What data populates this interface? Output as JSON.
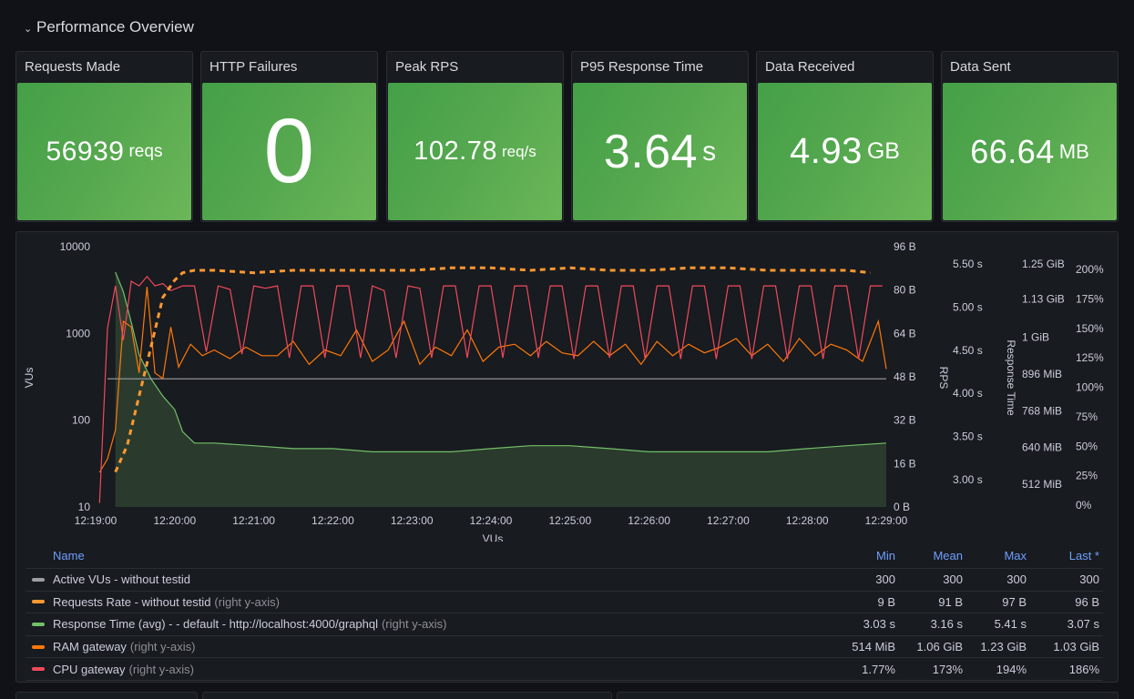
{
  "row": {
    "title": "Performance Overview",
    "chevron_icon": "chevron-down-icon"
  },
  "stats": [
    {
      "title": "Requests Made",
      "value": "56939",
      "unit": "reqs"
    },
    {
      "title": "HTTP Failures",
      "value": "0",
      "unit": ""
    },
    {
      "title": "Peak RPS",
      "value": "102.78",
      "unit": "req/s"
    },
    {
      "title": "P95 Response Time",
      "value": "3.64",
      "unit": "s"
    },
    {
      "title": "Data Received",
      "value": "4.93",
      "unit": "GB"
    },
    {
      "title": "Data Sent",
      "value": "66.64",
      "unit": "MB"
    }
  ],
  "colors": {
    "stat_green": "#56a84f",
    "vus": "#9d9da3",
    "requests_rate": "#ff9830",
    "response_time": "#73bf69",
    "ram": "#ff780a",
    "cpu": "#f2495c",
    "legend_header": "#6e9fff"
  },
  "chart_data": {
    "type": "line",
    "title": "",
    "xlabel": "VUs",
    "x_ticks": [
      "12:19:00",
      "12:20:00",
      "12:21:00",
      "12:22:00",
      "12:23:00",
      "12:24:00",
      "12:25:00",
      "12:26:00",
      "12:27:00",
      "12:28:00",
      "12:29:00"
    ],
    "x_range_minutes": [
      0,
      10
    ],
    "axes": {
      "left": {
        "label": "VUs",
        "scale": "log",
        "range": [
          10,
          10000
        ],
        "ticks": [
          "10",
          "100",
          "1000",
          "10000"
        ]
      },
      "rps": {
        "label": "RPS",
        "range": [
          0,
          96
        ],
        "ticks": [
          "0 B",
          "16 B",
          "32 B",
          "48 B",
          "64 B",
          "80 B",
          "96 B"
        ]
      },
      "resp": {
        "label": "Response Time",
        "range": [
          2.75,
          5.5
        ],
        "ticks": [
          "3.00 s",
          "3.50 s",
          "4.00 s",
          "4.50 s",
          "5.00 s",
          "5.50 s"
        ]
      },
      "ram": {
        "label": "",
        "range_mib": [
          384,
          1280
        ],
        "ticks": [
          "512 MiB",
          "640 MiB",
          "768 MiB",
          "896 MiB",
          "1 GiB",
          "1.13 GiB",
          "1.25 GiB"
        ]
      },
      "cpu": {
        "label": "",
        "range": [
          0,
          200
        ],
        "ticks": [
          "0%",
          "25%",
          "50%",
          "75%",
          "100%",
          "125%",
          "150%",
          "175%",
          "200%"
        ]
      }
    },
    "series": [
      {
        "name": "Active VUs - without testid",
        "axis": "left",
        "style": "solid",
        "values_desc": "constant 300 from 12:19:10 to 12:29:00",
        "x": [
          0.15,
          10
        ],
        "y": [
          300,
          300
        ]
      },
      {
        "name": "Requests Rate - without testid",
        "axis": "rps",
        "style": "dashed",
        "x": [
          0.25,
          0.4,
          0.55,
          0.7,
          0.85,
          1.0,
          1.1,
          1.25,
          1.5,
          2,
          2.5,
          3,
          3.5,
          4,
          4.5,
          5,
          5.5,
          6,
          6.5,
          7,
          7.5,
          8,
          8.5,
          9,
          9.5,
          9.8
        ],
        "y": [
          9,
          25,
          45,
          65,
          85,
          92,
          95,
          96,
          96,
          95,
          96,
          96,
          96,
          96,
          97,
          97,
          96,
          97,
          96,
          96,
          97,
          97,
          96,
          96,
          96,
          95
        ]
      },
      {
        "name": "Response Time (avg) - - default - http://localhost:4000/graphql",
        "axis": "resp",
        "style": "area",
        "x": [
          0.25,
          0.35,
          0.45,
          0.55,
          0.7,
          0.85,
          1.0,
          1.1,
          1.25,
          1.5,
          2,
          2.5,
          3,
          3.5,
          4,
          4.5,
          5,
          5.5,
          6,
          6.5,
          7,
          7.5,
          8,
          8.5,
          9,
          9.5,
          10
        ],
        "y": [
          5.41,
          4.6,
          4.15,
          3.75,
          3.5,
          3.35,
          3.25,
          3.12,
          3.07,
          3.07,
          3.06,
          3.05,
          3.05,
          3.04,
          3.04,
          3.04,
          3.05,
          3.06,
          3.06,
          3.05,
          3.04,
          3.04,
          3.04,
          3.04,
          3.05,
          3.06,
          3.07
        ]
      },
      {
        "name": "RAM gateway",
        "axis": "ram",
        "x": [
          0.05,
          0.15,
          0.25,
          0.35,
          0.45,
          0.55,
          0.65,
          0.75,
          0.85,
          0.95,
          1.05,
          1.2,
          1.35,
          1.5,
          1.7,
          1.9,
          2.1,
          2.3,
          2.5,
          2.7,
          2.9,
          3.1,
          3.3,
          3.5,
          3.7,
          3.9,
          4.1,
          4.3,
          4.5,
          4.7,
          4.9,
          5.1,
          5.3,
          5.5,
          5.7,
          5.9,
          6.1,
          6.3,
          6.5,
          6.7,
          6.9,
          7.1,
          7.3,
          7.5,
          7.7,
          7.9,
          8.1,
          8.3,
          8.5,
          8.7,
          8.9,
          9.1,
          9.3,
          9.5,
          9.7,
          9.9,
          10
        ],
        "y": [
          514,
          600,
          700,
          1080,
          1060,
          900,
          1200,
          900,
          880,
          1060,
          920,
          1000,
          960,
          980,
          950,
          990,
          960,
          960,
          1010,
          930,
          980,
          960,
          1050,
          940,
          980,
          1080,
          930,
          990,
          960,
          1050,
          940,
          990,
          1000,
          960,
          1010,
          970,
          960,
          1010,
          960,
          1000,
          930,
          1010,
          960,
          1000,
          970,
          990,
          1020,
          960,
          1000,
          940,
          1020,
          960,
          1000,
          980,
          940,
          1080,
          914
        ]
      },
      {
        "name": "CPU gateway",
        "axis": "cpu",
        "x": [
          0.05,
          0.15,
          0.25,
          0.35,
          0.45,
          0.55,
          0.65,
          0.75,
          0.85,
          0.95,
          1.1,
          1.25,
          1.4,
          1.55,
          1.7,
          1.85,
          2.0,
          2.15,
          2.3,
          2.45,
          2.6,
          2.75,
          2.9,
          3.05,
          3.2,
          3.35,
          3.5,
          3.65,
          3.8,
          3.95,
          4.1,
          4.25,
          4.4,
          4.55,
          4.7,
          4.85,
          5.0,
          5.15,
          5.3,
          5.45,
          5.6,
          5.75,
          5.9,
          6.05,
          6.2,
          6.35,
          6.5,
          6.65,
          6.8,
          6.95,
          7.1,
          7.25,
          7.4,
          7.55,
          7.7,
          7.85,
          8.0,
          8.15,
          8.3,
          8.45,
          8.6,
          8.75,
          8.9,
          9.05,
          9.2,
          9.35,
          9.5,
          9.65,
          9.8,
          9.95
        ],
        "y": [
          1.77,
          150,
          186,
          140,
          190,
          186,
          194,
          186,
          188,
          182,
          186,
          186,
          130,
          186,
          183,
          128,
          186,
          184,
          186,
          125,
          186,
          186,
          125,
          186,
          186,
          125,
          186,
          182,
          125,
          186,
          184,
          125,
          186,
          186,
          125,
          186,
          186,
          125,
          186,
          186,
          125,
          186,
          186,
          124,
          186,
          186,
          125,
          186,
          186,
          124,
          186,
          186,
          124,
          186,
          186,
          124,
          186,
          186,
          124,
          186,
          186,
          124,
          186,
          186,
          124,
          186,
          186,
          124,
          186,
          186
        ]
      }
    ],
    "legend": {
      "placement": "bottom",
      "columns": [
        "Name",
        "Min",
        "Mean",
        "Max",
        "Last *"
      ],
      "rows": [
        {
          "name": "Active VUs - without testid",
          "suffix": "",
          "color": "#9d9da3",
          "min": "300",
          "mean": "300",
          "max": "300",
          "last": "300"
        },
        {
          "name": "Requests Rate - without testid",
          "suffix": "(right y-axis)",
          "color": "#ff9830",
          "min": "9 B",
          "mean": "91 B",
          "max": "97 B",
          "last": "96 B"
        },
        {
          "name": "Response Time (avg) - - default - http://localhost:4000/graphql",
          "suffix": "(right y-axis)",
          "color": "#73bf69",
          "min": "3.03 s",
          "mean": "3.16 s",
          "max": "5.41 s",
          "last": "3.07 s"
        },
        {
          "name": "RAM gateway",
          "suffix": "(right y-axis)",
          "color": "#ff780a",
          "min": "514 MiB",
          "mean": "1.06 GiB",
          "max": "1.23 GiB",
          "last": "1.03 GiB"
        },
        {
          "name": "CPU gateway",
          "suffix": "(right y-axis)",
          "color": "#f2495c",
          "min": "1.77%",
          "mean": "173%",
          "max": "194%",
          "last": "186%"
        }
      ]
    }
  }
}
